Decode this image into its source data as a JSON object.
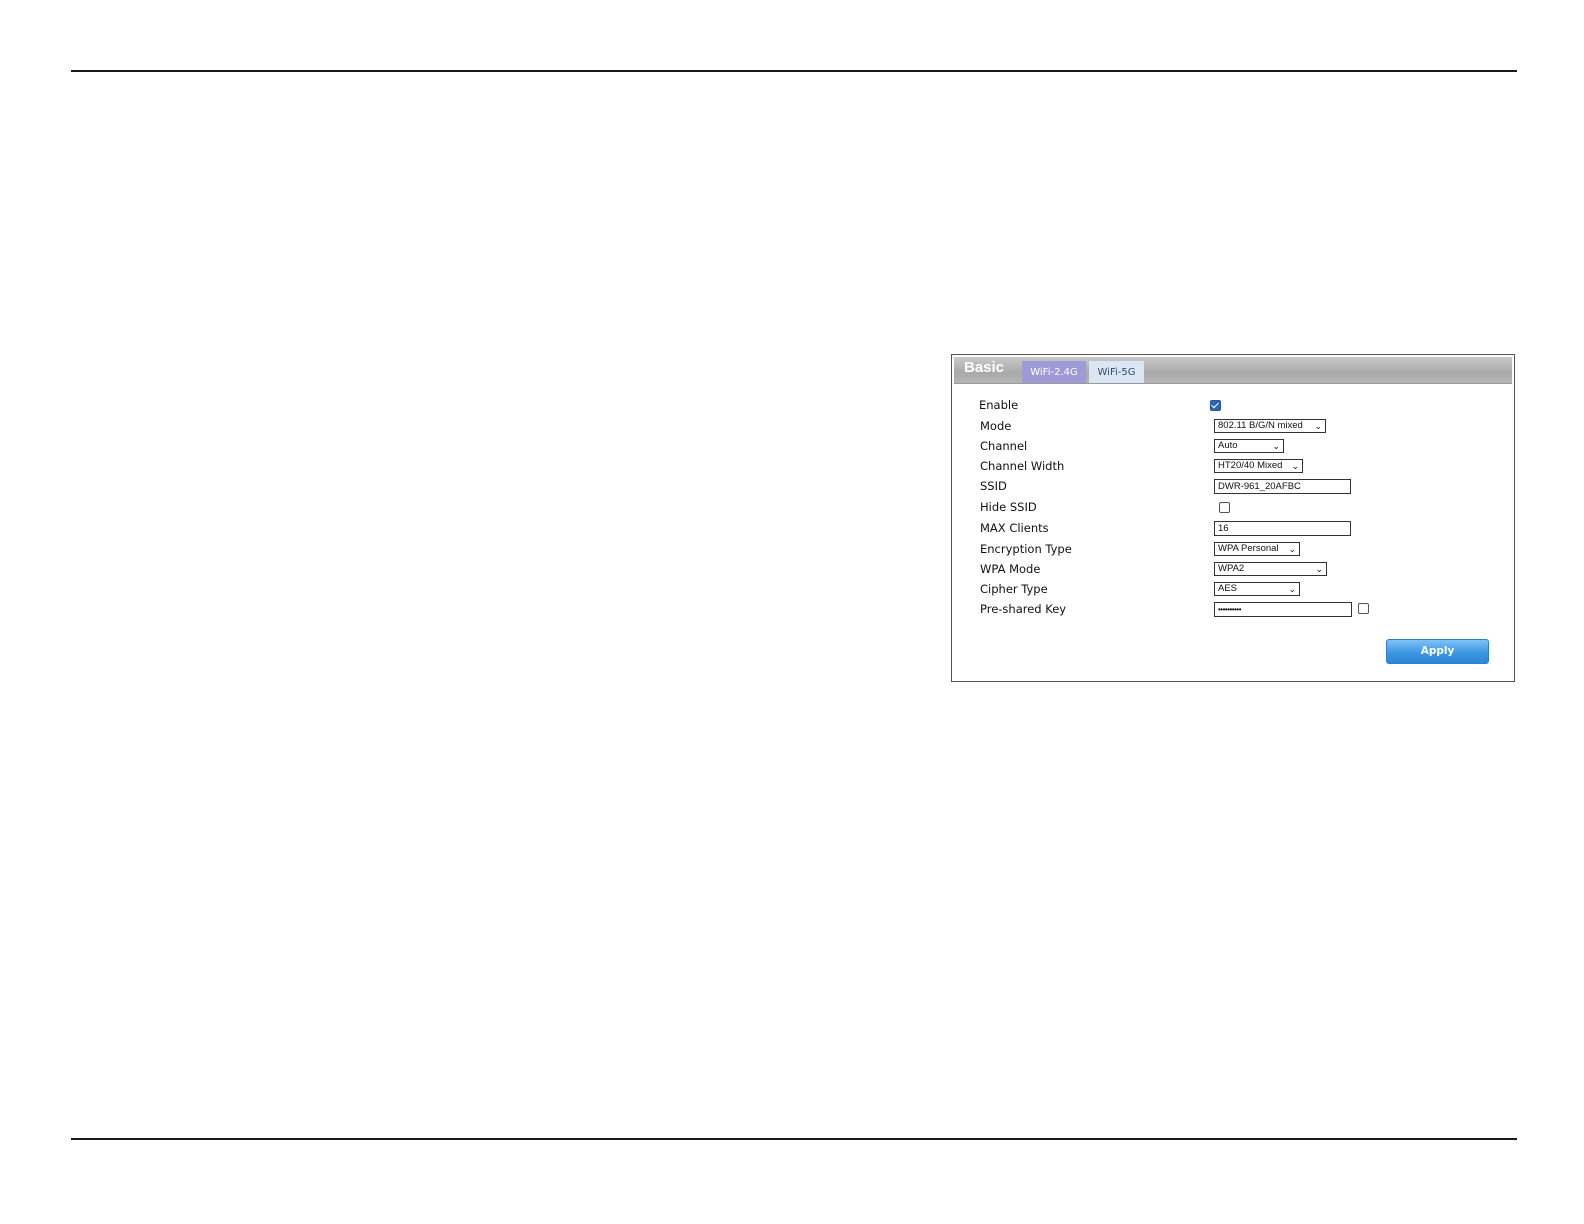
{
  "panel": {
    "title": "Basic",
    "tabs": [
      {
        "label": "WiFi-2.4G",
        "active": true
      },
      {
        "label": "WiFi-5G",
        "active": false
      }
    ]
  },
  "form": {
    "enable": {
      "label": "Enable",
      "checked": true
    },
    "mode": {
      "label": "Mode",
      "value": "802.11 B/G/N mixed"
    },
    "channel": {
      "label": "Channel",
      "value": "Auto"
    },
    "channel_width": {
      "label": "Channel Width",
      "value": "HT20/40 Mixed"
    },
    "ssid": {
      "label": "SSID",
      "value": "DWR-961_20AFBC"
    },
    "hide_ssid": {
      "label": "Hide SSID",
      "checked": false
    },
    "max_clients": {
      "label": "MAX Clients",
      "value": "16"
    },
    "encryption_type": {
      "label": "Encryption Type",
      "value": "WPA Personal"
    },
    "wpa_mode": {
      "label": "WPA Mode",
      "value": "WPA2"
    },
    "cipher_type": {
      "label": "Cipher Type",
      "value": "AES"
    },
    "pre_shared_key": {
      "label": "Pre-shared Key",
      "value": "••••••••••",
      "show_checked": false
    }
  },
  "buttons": {
    "apply": "Apply"
  },
  "colors": {
    "tab_active": "#9e9ad6",
    "tab_inactive": "#dbe6f4",
    "apply_button": "#3c97e3",
    "header_bar": "#b5b5b5"
  },
  "icons": {
    "select_arrow": "chevron-down-icon",
    "checkbox": "checkbox-icon"
  }
}
